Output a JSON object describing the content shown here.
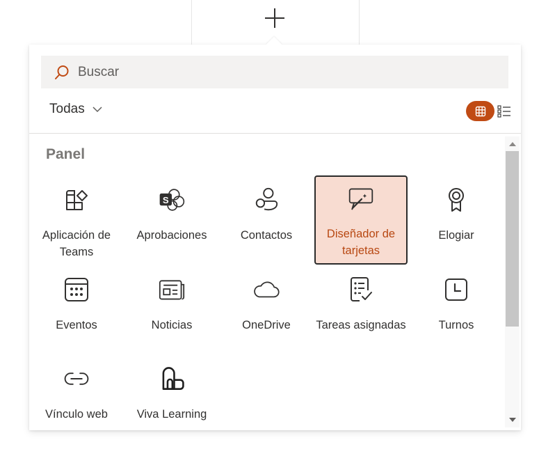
{
  "search": {
    "placeholder": "Buscar",
    "value": ""
  },
  "filter": {
    "label": "Todas"
  },
  "section": {
    "title": "Panel"
  },
  "colors": {
    "accent": "#c04b14",
    "selected_bg": "#f8dcd1",
    "selected_text": "#b84812"
  },
  "tiles": [
    {
      "label": "Aplicación de Teams",
      "icon": "teams-app-icon"
    },
    {
      "label": "Aprobaciones",
      "icon": "approvals-icon"
    },
    {
      "label": "Contactos",
      "icon": "contacts-icon"
    },
    {
      "label": "Diseñador de tarjetas",
      "icon": "card-designer-icon",
      "selected": true
    },
    {
      "label": "Elogiar",
      "icon": "praise-icon"
    },
    {
      "label": "Eventos",
      "icon": "events-icon"
    },
    {
      "label": "Noticias",
      "icon": "news-icon"
    },
    {
      "label": "OneDrive",
      "icon": "onedrive-icon"
    },
    {
      "label": "Tareas asignadas",
      "icon": "assigned-tasks-icon"
    },
    {
      "label": "Turnos",
      "icon": "shifts-icon"
    },
    {
      "label": "Vínculo web",
      "icon": "web-link-icon"
    },
    {
      "label": "Viva Learning",
      "icon": "viva-learning-icon"
    }
  ]
}
